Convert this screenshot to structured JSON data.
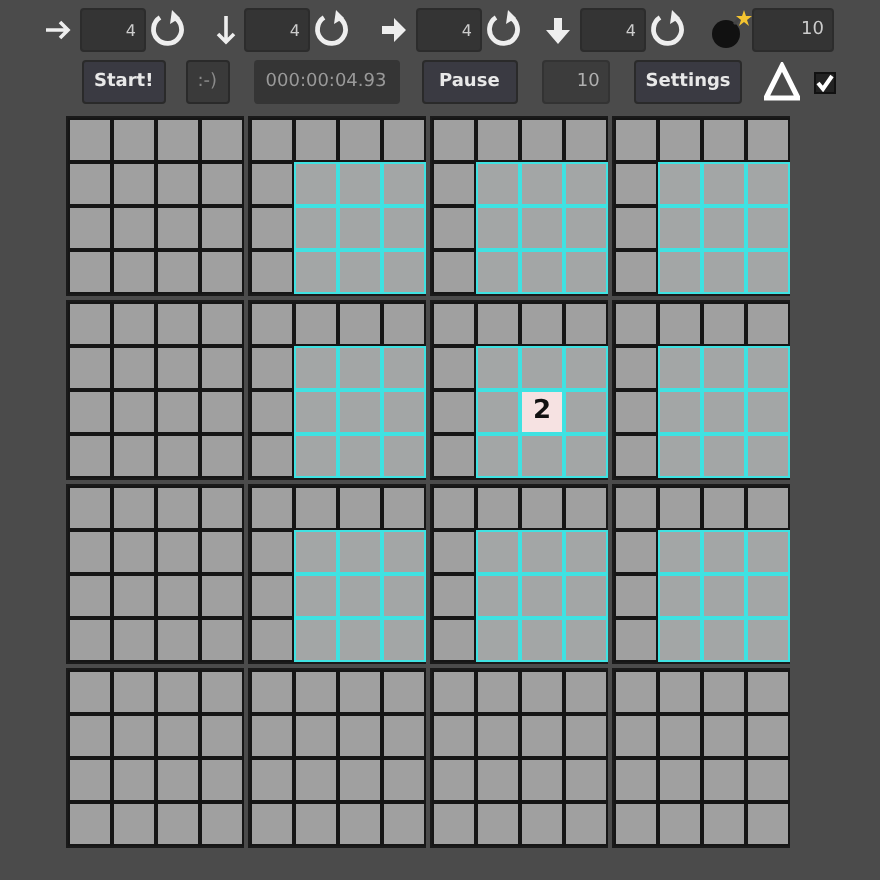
{
  "toolbar": {
    "size_fields": [
      {
        "kind": "thin-right",
        "value": "4"
      },
      {
        "kind": "thin-down",
        "value": "4"
      },
      {
        "kind": "bold-right",
        "value": "4"
      },
      {
        "kind": "bold-down",
        "value": "4"
      }
    ],
    "mines": {
      "value": "10"
    }
  },
  "controls": {
    "start": "Start!",
    "smiley": {
      "label": ":-)",
      "disabled": true
    },
    "timer": "000:00:04.93",
    "pause": "Pause",
    "count": {
      "value": "10",
      "disabled": true
    },
    "settings": "Settings",
    "option_checked": true
  },
  "board": {
    "blocks": [
      [
        {
          "cells": [
            [
              {
                "kind": "covered"
              },
              {
                "kind": "covered"
              },
              {
                "kind": "covered"
              },
              {
                "kind": "covered"
              }
            ],
            [
              {
                "kind": "covered"
              },
              {
                "kind": "covered"
              },
              {
                "kind": "covered"
              },
              {
                "kind": "covered"
              }
            ],
            [
              {
                "kind": "covered"
              },
              {
                "kind": "covered"
              },
              {
                "kind": "covered"
              },
              {
                "kind": "covered"
              }
            ],
            [
              {
                "kind": "covered"
              },
              {
                "kind": "covered"
              },
              {
                "kind": "covered"
              },
              {
                "kind": "covered"
              }
            ]
          ]
        },
        {
          "cells": [
            [
              {
                "kind": "covered"
              },
              {
                "kind": "covered"
              },
              {
                "kind": "covered"
              },
              {
                "kind": "covered"
              }
            ],
            [
              {
                "kind": "covered"
              },
              {
                "kind": "highlighted"
              },
              {
                "kind": "highlighted"
              },
              {
                "kind": "highlighted"
              }
            ],
            [
              {
                "kind": "covered"
              },
              {
                "kind": "highlighted"
              },
              {
                "kind": "highlighted"
              },
              {
                "kind": "highlighted"
              }
            ],
            [
              {
                "kind": "covered"
              },
              {
                "kind": "highlighted"
              },
              {
                "kind": "highlighted"
              },
              {
                "kind": "highlighted"
              }
            ]
          ]
        },
        {
          "cells": [
            [
              {
                "kind": "covered"
              },
              {
                "kind": "covered"
              },
              {
                "kind": "covered"
              },
              {
                "kind": "covered"
              }
            ],
            [
              {
                "kind": "covered"
              },
              {
                "kind": "highlighted"
              },
              {
                "kind": "highlighted"
              },
              {
                "kind": "highlighted"
              }
            ],
            [
              {
                "kind": "covered"
              },
              {
                "kind": "highlighted"
              },
              {
                "kind": "highlighted"
              },
              {
                "kind": "highlighted"
              }
            ],
            [
              {
                "kind": "covered"
              },
              {
                "kind": "highlighted"
              },
              {
                "kind": "highlighted"
              },
              {
                "kind": "highlighted"
              }
            ]
          ]
        },
        {
          "cells": [
            [
              {
                "kind": "covered"
              },
              {
                "kind": "covered"
              },
              {
                "kind": "covered"
              },
              {
                "kind": "covered"
              }
            ],
            [
              {
                "kind": "covered"
              },
              {
                "kind": "highlighted"
              },
              {
                "kind": "highlighted"
              },
              {
                "kind": "highlighted"
              }
            ],
            [
              {
                "kind": "covered"
              },
              {
                "kind": "highlighted"
              },
              {
                "kind": "highlighted"
              },
              {
                "kind": "highlighted"
              }
            ],
            [
              {
                "kind": "covered"
              },
              {
                "kind": "highlighted"
              },
              {
                "kind": "highlighted"
              },
              {
                "kind": "highlighted"
              }
            ]
          ]
        }
      ],
      [
        {
          "cells": [
            [
              {
                "kind": "covered"
              },
              {
                "kind": "covered"
              },
              {
                "kind": "covered"
              },
              {
                "kind": "covered"
              }
            ],
            [
              {
                "kind": "covered"
              },
              {
                "kind": "covered"
              },
              {
                "kind": "covered"
              },
              {
                "kind": "covered"
              }
            ],
            [
              {
                "kind": "covered"
              },
              {
                "kind": "covered"
              },
              {
                "kind": "covered"
              },
              {
                "kind": "covered"
              }
            ],
            [
              {
                "kind": "covered"
              },
              {
                "kind": "covered"
              },
              {
                "kind": "covered"
              },
              {
                "kind": "covered"
              }
            ]
          ]
        },
        {
          "cells": [
            [
              {
                "kind": "covered"
              },
              {
                "kind": "covered"
              },
              {
                "kind": "covered"
              },
              {
                "kind": "covered"
              }
            ],
            [
              {
                "kind": "covered"
              },
              {
                "kind": "highlighted"
              },
              {
                "kind": "highlighted"
              },
              {
                "kind": "highlighted"
              }
            ],
            [
              {
                "kind": "covered"
              },
              {
                "kind": "highlighted"
              },
              {
                "kind": "highlighted"
              },
              {
                "kind": "highlighted"
              }
            ],
            [
              {
                "kind": "covered"
              },
              {
                "kind": "highlighted"
              },
              {
                "kind": "highlighted"
              },
              {
                "kind": "highlighted"
              }
            ]
          ]
        },
        {
          "cells": [
            [
              {
                "kind": "covered"
              },
              {
                "kind": "covered"
              },
              {
                "kind": "covered"
              },
              {
                "kind": "covered"
              }
            ],
            [
              {
                "kind": "covered"
              },
              {
                "kind": "highlighted"
              },
              {
                "kind": "highlighted"
              },
              {
                "kind": "highlighted"
              }
            ],
            [
              {
                "kind": "covered"
              },
              {
                "kind": "highlighted"
              },
              {
                "kind": "revealed",
                "label": "2"
              },
              {
                "kind": "highlighted"
              }
            ],
            [
              {
                "kind": "covered"
              },
              {
                "kind": "highlighted"
              },
              {
                "kind": "highlighted"
              },
              {
                "kind": "highlighted"
              }
            ]
          ]
        },
        {
          "cells": [
            [
              {
                "kind": "covered"
              },
              {
                "kind": "covered"
              },
              {
                "kind": "covered"
              },
              {
                "kind": "covered"
              }
            ],
            [
              {
                "kind": "covered"
              },
              {
                "kind": "highlighted"
              },
              {
                "kind": "highlighted"
              },
              {
                "kind": "highlighted"
              }
            ],
            [
              {
                "kind": "covered"
              },
              {
                "kind": "highlighted"
              },
              {
                "kind": "highlighted"
              },
              {
                "kind": "highlighted"
              }
            ],
            [
              {
                "kind": "covered"
              },
              {
                "kind": "highlighted"
              },
              {
                "kind": "highlighted"
              },
              {
                "kind": "highlighted"
              }
            ]
          ]
        }
      ],
      [
        {
          "cells": [
            [
              {
                "kind": "covered"
              },
              {
                "kind": "covered"
              },
              {
                "kind": "covered"
              },
              {
                "kind": "covered"
              }
            ],
            [
              {
                "kind": "covered"
              },
              {
                "kind": "covered"
              },
              {
                "kind": "covered"
              },
              {
                "kind": "covered"
              }
            ],
            [
              {
                "kind": "covered"
              },
              {
                "kind": "covered"
              },
              {
                "kind": "covered"
              },
              {
                "kind": "covered"
              }
            ],
            [
              {
                "kind": "covered"
              },
              {
                "kind": "covered"
              },
              {
                "kind": "covered"
              },
              {
                "kind": "covered"
              }
            ]
          ]
        },
        {
          "cells": [
            [
              {
                "kind": "covered"
              },
              {
                "kind": "covered"
              },
              {
                "kind": "covered"
              },
              {
                "kind": "covered"
              }
            ],
            [
              {
                "kind": "covered"
              },
              {
                "kind": "highlighted"
              },
              {
                "kind": "highlighted"
              },
              {
                "kind": "highlighted"
              }
            ],
            [
              {
                "kind": "covered"
              },
              {
                "kind": "highlighted"
              },
              {
                "kind": "highlighted"
              },
              {
                "kind": "highlighted"
              }
            ],
            [
              {
                "kind": "covered"
              },
              {
                "kind": "highlighted"
              },
              {
                "kind": "highlighted"
              },
              {
                "kind": "highlighted"
              }
            ]
          ]
        },
        {
          "cells": [
            [
              {
                "kind": "covered"
              },
              {
                "kind": "covered"
              },
              {
                "kind": "covered"
              },
              {
                "kind": "covered"
              }
            ],
            [
              {
                "kind": "covered"
              },
              {
                "kind": "highlighted"
              },
              {
                "kind": "highlighted"
              },
              {
                "kind": "highlighted"
              }
            ],
            [
              {
                "kind": "covered"
              },
              {
                "kind": "highlighted"
              },
              {
                "kind": "highlighted"
              },
              {
                "kind": "highlighted"
              }
            ],
            [
              {
                "kind": "covered"
              },
              {
                "kind": "highlighted"
              },
              {
                "kind": "highlighted"
              },
              {
                "kind": "highlighted"
              }
            ]
          ]
        },
        {
          "cells": [
            [
              {
                "kind": "covered"
              },
              {
                "kind": "covered"
              },
              {
                "kind": "covered"
              },
              {
                "kind": "covered"
              }
            ],
            [
              {
                "kind": "covered"
              },
              {
                "kind": "highlighted"
              },
              {
                "kind": "highlighted"
              },
              {
                "kind": "highlighted"
              }
            ],
            [
              {
                "kind": "covered"
              },
              {
                "kind": "highlighted"
              },
              {
                "kind": "highlighted"
              },
              {
                "kind": "highlighted"
              }
            ],
            [
              {
                "kind": "covered"
              },
              {
                "kind": "highlighted"
              },
              {
                "kind": "highlighted"
              },
              {
                "kind": "highlighted"
              }
            ]
          ]
        }
      ],
      [
        {
          "cells": [
            [
              {
                "kind": "covered"
              },
              {
                "kind": "covered"
              },
              {
                "kind": "covered"
              },
              {
                "kind": "covered"
              }
            ],
            [
              {
                "kind": "covered"
              },
              {
                "kind": "covered"
              },
              {
                "kind": "covered"
              },
              {
                "kind": "covered"
              }
            ],
            [
              {
                "kind": "covered"
              },
              {
                "kind": "covered"
              },
              {
                "kind": "covered"
              },
              {
                "kind": "covered"
              }
            ],
            [
              {
                "kind": "covered"
              },
              {
                "kind": "covered"
              },
              {
                "kind": "covered"
              },
              {
                "kind": "covered"
              }
            ]
          ]
        },
        {
          "cells": [
            [
              {
                "kind": "covered"
              },
              {
                "kind": "covered"
              },
              {
                "kind": "covered"
              },
              {
                "kind": "covered"
              }
            ],
            [
              {
                "kind": "covered"
              },
              {
                "kind": "covered"
              },
              {
                "kind": "covered"
              },
              {
                "kind": "covered"
              }
            ],
            [
              {
                "kind": "covered"
              },
              {
                "kind": "covered"
              },
              {
                "kind": "covered"
              },
              {
                "kind": "covered"
              }
            ],
            [
              {
                "kind": "covered"
              },
              {
                "kind": "covered"
              },
              {
                "kind": "covered"
              },
              {
                "kind": "covered"
              }
            ]
          ]
        },
        {
          "cells": [
            [
              {
                "kind": "covered"
              },
              {
                "kind": "covered"
              },
              {
                "kind": "covered"
              },
              {
                "kind": "covered"
              }
            ],
            [
              {
                "kind": "covered"
              },
              {
                "kind": "covered"
              },
              {
                "kind": "covered"
              },
              {
                "kind": "covered"
              }
            ],
            [
              {
                "kind": "covered"
              },
              {
                "kind": "covered"
              },
              {
                "kind": "covered"
              },
              {
                "kind": "covered"
              }
            ],
            [
              {
                "kind": "covered"
              },
              {
                "kind": "covered"
              },
              {
                "kind": "covered"
              },
              {
                "kind": "covered"
              }
            ]
          ]
        },
        {
          "cells": [
            [
              {
                "kind": "covered"
              },
              {
                "kind": "covered"
              },
              {
                "kind": "covered"
              },
              {
                "kind": "covered"
              }
            ],
            [
              {
                "kind": "covered"
              },
              {
                "kind": "covered"
              },
              {
                "kind": "covered"
              },
              {
                "kind": "covered"
              }
            ],
            [
              {
                "kind": "covered"
              },
              {
                "kind": "covered"
              },
              {
                "kind": "covered"
              },
              {
                "kind": "covered"
              }
            ],
            [
              {
                "kind": "covered"
              },
              {
                "kind": "covered"
              },
              {
                "kind": "covered"
              },
              {
                "kind": "covered"
              }
            ]
          ]
        }
      ]
    ]
  }
}
